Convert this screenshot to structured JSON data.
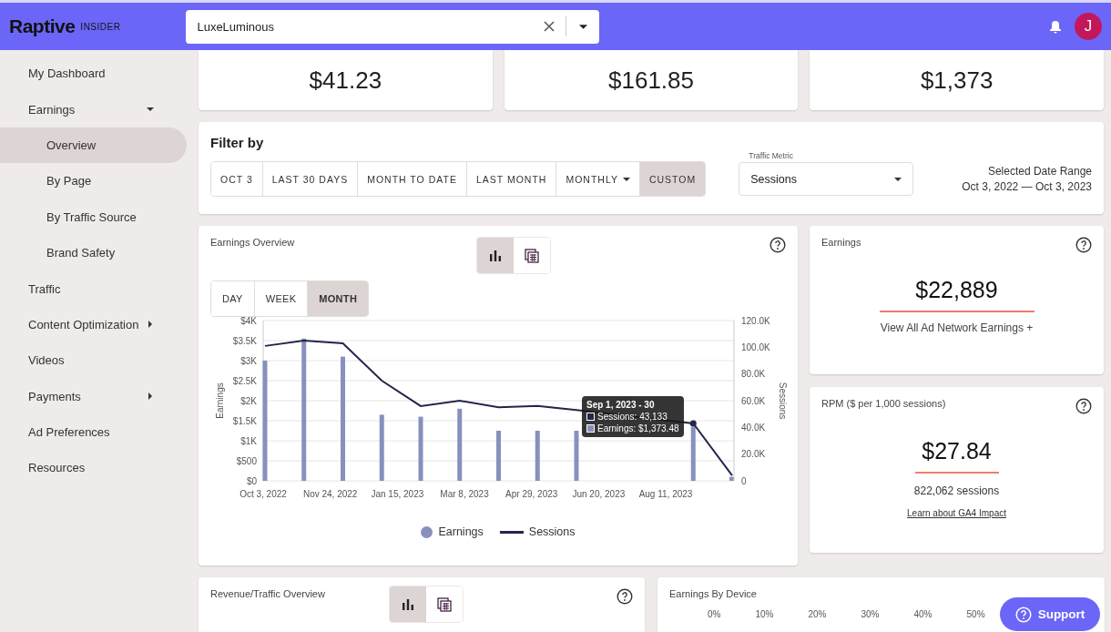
{
  "header": {
    "logo": "Raptive",
    "logo_suffix": "INSIDER",
    "site_select": {
      "value": "LuxeLuminous"
    },
    "avatar": "J"
  },
  "sidebar": {
    "items": [
      {
        "label": "My Dashboard",
        "kind": "link",
        "selected": false
      },
      {
        "label": "Earnings",
        "kind": "group",
        "expanded": true,
        "selected": false,
        "children": [
          {
            "label": "Overview",
            "selected": true
          },
          {
            "label": "By Page",
            "selected": false
          },
          {
            "label": "By Traffic Source",
            "selected": false
          },
          {
            "label": "Brand Safety",
            "selected": false
          }
        ]
      },
      {
        "label": "Traffic",
        "kind": "link",
        "selected": false
      },
      {
        "label": "Content Optimization",
        "kind": "group",
        "expanded": false,
        "selected": false
      },
      {
        "label": "Videos",
        "kind": "link",
        "selected": false
      },
      {
        "label": "Payments",
        "kind": "group",
        "expanded": false,
        "selected": false
      },
      {
        "label": "Ad Preferences",
        "kind": "link",
        "selected": false
      },
      {
        "label": "Resources",
        "kind": "link",
        "selected": false
      }
    ]
  },
  "summary_cards": [
    {
      "value": "$41.23"
    },
    {
      "value": "$161.85"
    },
    {
      "value": "$1,373"
    }
  ],
  "filter": {
    "title": "Filter by",
    "ranges": [
      {
        "label": "OCT 3",
        "kind": "button",
        "selected": false
      },
      {
        "label": "LAST 30 DAYS",
        "kind": "button",
        "selected": false
      },
      {
        "label": "MONTH TO DATE",
        "kind": "button",
        "selected": false
      },
      {
        "label": "LAST MONTH",
        "kind": "button",
        "selected": false
      },
      {
        "label": "MONTHLY",
        "kind": "dropdown",
        "selected": false
      },
      {
        "label": "CUSTOM",
        "kind": "button",
        "selected": true
      }
    ],
    "traffic_metric": {
      "label": "Traffic Metric",
      "value": "Sessions"
    },
    "date_range": {
      "label": "Selected Date Range",
      "value": "Oct 3, 2022 — Oct 3, 2023"
    }
  },
  "earnings_overview": {
    "title": "Earnings Overview",
    "views": [
      {
        "kind": "chart",
        "selected": true
      },
      {
        "kind": "table",
        "selected": false
      }
    ],
    "periods": [
      {
        "label": "DAY",
        "selected": false
      },
      {
        "label": "WEEK",
        "selected": false
      },
      {
        "label": "MONTH",
        "selected": true
      }
    ],
    "x_labels": [
      "Oct 3, 2022",
      "Nov 24, 2022",
      "Jan 15, 2023",
      "Mar 8, 2023",
      "Apr 29, 2023",
      "Jun 20, 2023",
      "Aug 11, 2023"
    ],
    "earnings_axis": {
      "chart_data": {
        "type": "bar",
        "ylabel": "Earnings",
        "grid": true,
        "series": [
          {
            "name": "Earnings",
            "color": "#8890bd",
            "values": [
              3000,
              3550,
              3100,
              1650,
              1600,
              1800,
              1250,
              1250,
              1250,
              null,
              null,
              1350,
              100
            ]
          }
        ],
        "ylim": [
          0,
          4000
        ],
        "yticks": [
          {
            "value": 0,
            "label": "$0"
          },
          {
            "value": 500,
            "label": "$500"
          },
          {
            "value": 1000,
            "label": "$1K"
          },
          {
            "value": 1500,
            "label": "$1.5K"
          },
          {
            "value": 2000,
            "label": "$2K"
          },
          {
            "value": 2500,
            "label": "$2.5K"
          },
          {
            "value": 3000,
            "label": "$3K"
          },
          {
            "value": 3500,
            "label": "$3.5K"
          },
          {
            "value": 4000,
            "label": "$4K"
          }
        ]
      }
    },
    "sessions_axis": {
      "chart_data": {
        "type": "line",
        "ylabel": "Sessions",
        "series": [
          {
            "name": "Sessions",
            "color": "#24254a",
            "values": [
              101000,
              105000,
              103000,
              75000,
              56000,
              60000,
              55000,
              56000,
              53000,
              null,
              null,
              43000,
              4000
            ]
          }
        ],
        "ylim": [
          0,
          120000
        ],
        "yticks": [
          {
            "value": 0,
            "label": "0"
          },
          {
            "value": 20000,
            "label": "20.0K"
          },
          {
            "value": 40000,
            "label": "40.0K"
          },
          {
            "value": 60000,
            "label": "60.0K"
          },
          {
            "value": 80000,
            "label": "80.0K"
          },
          {
            "value": 100000,
            "label": "100.0K"
          },
          {
            "value": 120000,
            "label": "120.0K"
          }
        ]
      }
    },
    "tooltip": {
      "title": "Sep 1, 2023 - 30",
      "lines": [
        "Sessions: 43,133",
        "Earnings: $1,373.48"
      ]
    },
    "legend": [
      {
        "kind": "dot"
      },
      {
        "kind": "line"
      }
    ]
  },
  "earnings_card": {
    "title": "Earnings",
    "value": "$22,889",
    "link": "View All Ad Network Earnings +"
  },
  "rpm_card": {
    "title": "RPM ($ per 1,000 sessions)",
    "value": "$27.84",
    "note": "822,062 sessions",
    "link": "Learn about GA4 Impact"
  },
  "revenue_traffic": {
    "title": "Revenue/Traffic Overview",
    "views": [
      {
        "kind": "chart",
        "selected": true
      },
      {
        "kind": "table",
        "selected": false
      }
    ]
  },
  "device_card": {
    "title": "Earnings By Device",
    "ticks": [
      "0%",
      "10%",
      "20%",
      "30%",
      "40%",
      "50%"
    ]
  },
  "support_button": {
    "label": "Support"
  }
}
